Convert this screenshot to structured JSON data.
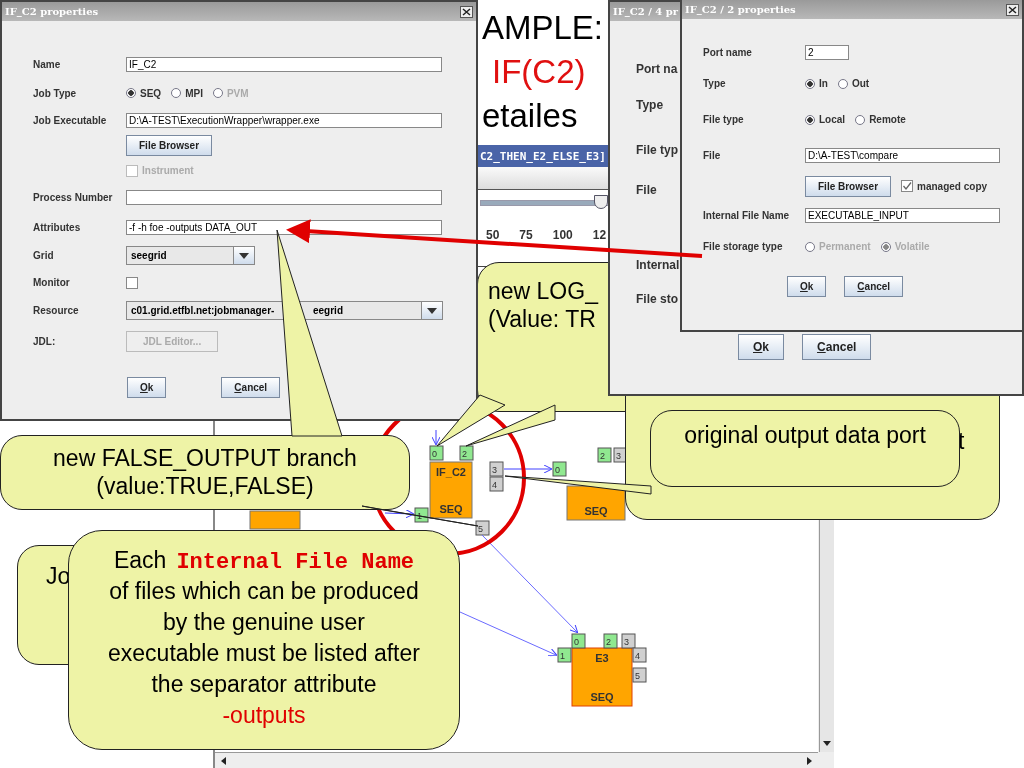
{
  "slide_title": {
    "line_1": "AMPLE:",
    "line_2": "IF(C2)",
    "line_3": "etailes"
  },
  "editor": {
    "title": "C2_THEN_E2_ELSE_E3]",
    "zoom": {
      "level": 0.67,
      "ticks": [
        "50",
        "75",
        "100",
        "12"
      ]
    }
  },
  "diagram": {
    "nodes": [
      {
        "name": "IF_C2",
        "type": "SEQ",
        "ports": [
          {
            "label": "0",
            "kind": "input"
          },
          {
            "label": "2",
            "kind": "input"
          },
          {
            "label": "3",
            "kind": "output"
          },
          {
            "label": "4",
            "kind": "output"
          },
          {
            "label": "1",
            "kind": "input"
          },
          {
            "label": "5",
            "kind": "output"
          }
        ]
      },
      {
        "type": "SEQ",
        "ports": [
          {
            "label": "0",
            "kind": "input"
          },
          {
            "label": "2",
            "kind": "input"
          },
          {
            "label": "3",
            "kind": "output"
          }
        ]
      },
      {
        "name": "E3",
        "type": "SEQ",
        "ports": [
          {
            "label": "0",
            "kind": "input"
          },
          {
            "label": "2",
            "kind": "input"
          },
          {
            "label": "3",
            "kind": "output"
          },
          {
            "label": "4",
            "kind": "output"
          },
          {
            "label": "5",
            "kind": "output"
          },
          {
            "label": "1",
            "kind": "input"
          }
        ]
      }
    ]
  },
  "job_dialog": {
    "title": "IF_C2 properties",
    "fields": [
      {
        "kind": "text",
        "label": "Name",
        "value": "IF_C2"
      },
      {
        "kind": "radios",
        "label": "Job Type",
        "options": [
          {
            "label": "SEQ",
            "selected": true,
            "disabled": false
          },
          {
            "label": "MPI",
            "selected": false,
            "disabled": false
          },
          {
            "label": "PVM",
            "selected": false,
            "disabled": true
          }
        ]
      },
      {
        "kind": "text",
        "label": "Job Executable",
        "value": "D:\\A-TEST\\ExecutionWrapper\\wrapper.exe"
      },
      {
        "kind": "button",
        "label": "File Browser",
        "disabled": false
      },
      {
        "kind": "check",
        "label": "Instrument",
        "checked": false,
        "disabled": true
      },
      {
        "kind": "text",
        "label": "Process Number"
      },
      {
        "kind": "text",
        "label": "Attributes",
        "value": "-f -h foe -outputs DATA_OUT"
      },
      {
        "kind": "select",
        "label": "Grid",
        "value": "seegrid",
        "wide": false
      },
      {
        "kind": "check",
        "label": "Monitor",
        "checked": false,
        "disabled": false
      },
      {
        "kind": "select",
        "label": "Resource",
        "value": "c01.grid.etfbl.net:jobmanager-",
        "wide": true,
        "tail": "eegrid"
      },
      {
        "kind": "button",
        "label": "JDL:",
        "text": "JDL Editor...",
        "disabled": true
      }
    ],
    "buttons": [
      "Ok",
      "Cancel"
    ]
  },
  "port_dialog_back": {
    "title": "IF_C2 / 4 pr",
    "labels": [
      "Port na",
      "Type",
      "File typ",
      "File",
      "Internal",
      "File sto"
    ],
    "buttons": [
      "Ok",
      "Cancel"
    ]
  },
  "port_dialog": {
    "title": "IF_C2 / 2 properties",
    "fields": [
      {
        "kind": "text",
        "label": "Port name",
        "value": "2",
        "short": true
      },
      {
        "kind": "radios",
        "label": "Type",
        "options": [
          {
            "label": "In",
            "selected": true,
            "disabled": false
          },
          {
            "label": "Out",
            "selected": false,
            "disabled": false
          }
        ]
      },
      {
        "kind": "radios",
        "label": "File type",
        "options": [
          {
            "label": "Local",
            "selected": true,
            "disabled": false
          },
          {
            "label": "Remote",
            "selected": false,
            "disabled": false
          }
        ]
      },
      {
        "kind": "text",
        "label": "File",
        "value": "D:\\A-TEST\\compare"
      },
      {
        "kind": "browse",
        "button": "File Browser",
        "check": {
          "label": "managed copy",
          "checked": true
        }
      },
      {
        "kind": "text",
        "label": "Internal File Name",
        "value": "EXECUTABLE_INPUT"
      },
      {
        "kind": "radios",
        "label": "File storage type",
        "options": [
          {
            "label": "Permanent",
            "selected": false,
            "disabled": true
          },
          {
            "label": "Volatile",
            "selected": true,
            "disabled": true
          }
        ]
      }
    ],
    "buttons": [
      "Ok",
      "Cancel"
    ]
  },
  "callouts": [
    {
      "kind": "log",
      "lines": [
        "new LOG_",
        "(Value: TR"
      ]
    },
    {
      "kind": "upload",
      "fragment": "t"
    },
    {
      "kind": "output",
      "lines": [
        "original output data port"
      ]
    },
    {
      "kind": "job",
      "lines": [
        "Jo"
      ]
    },
    {
      "kind": "false",
      "lines": [
        "new FALSE_OUTPUT branch",
        "(value:TRUE,FALSE)"
      ]
    },
    {
      "kind": "each",
      "lead": "Each",
      "term": "Internal File Name",
      "lines": [
        "of files which can be produced",
        "by the genuine user",
        "executable must be listed after",
        "the separator attribute"
      ],
      "emphasis": "-outputs"
    }
  ]
}
